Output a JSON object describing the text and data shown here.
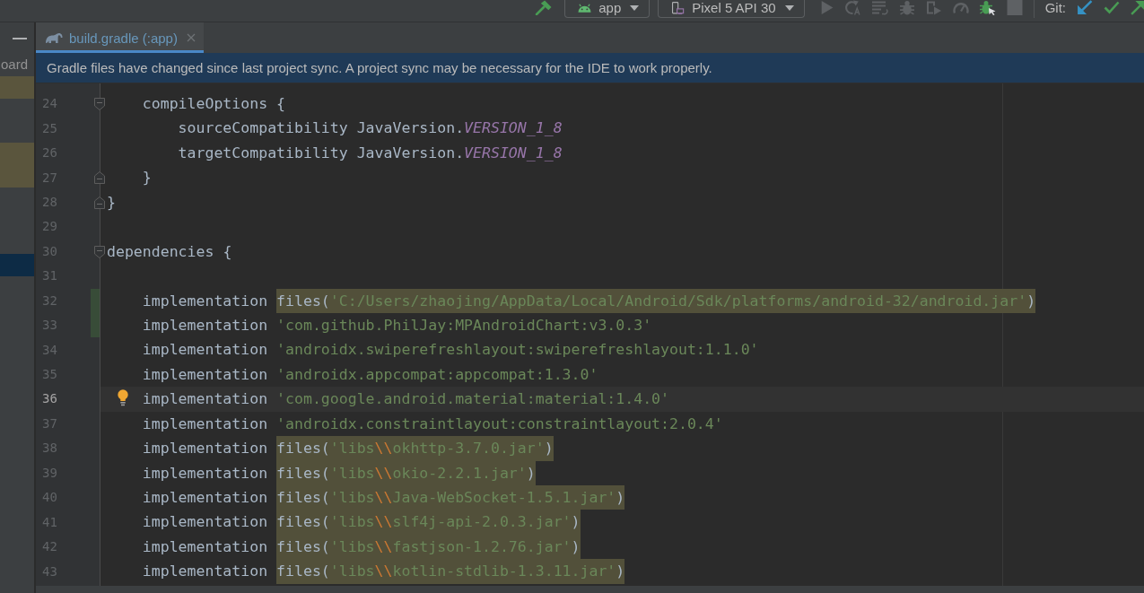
{
  "toolbar": {
    "leading_actions": [
      {
        "kind": "build",
        "disabled": false
      }
    ],
    "configurations": [
      {
        "kind": "module",
        "label": "app"
      },
      {
        "kind": "device",
        "label": "Pixel 5 API 30"
      }
    ],
    "actions": [
      {
        "kind": "run",
        "disabled": true
      },
      {
        "kind": "apply_changes",
        "disabled": true
      },
      {
        "kind": "apply_code_changes",
        "disabled": true
      },
      {
        "kind": "debug",
        "disabled": true
      },
      {
        "kind": "profile",
        "disabled": true
      },
      {
        "kind": "attach_profiler",
        "disabled": true
      },
      {
        "kind": "attach_debugger",
        "disabled": false
      },
      {
        "kind": "stop",
        "disabled": true
      }
    ],
    "git": {
      "label": "Git:"
    }
  },
  "side_panel": {
    "rows": [
      {
        "text": "oard",
        "highlighted": false,
        "selected": false
      },
      {
        "highlighted": true,
        "selected": false
      },
      {
        "highlighted": false,
        "selected": false
      },
      {
        "highlighted": false,
        "selected": false
      },
      {
        "highlighted": true,
        "selected": false
      },
      {
        "highlighted": true,
        "selected": false
      },
      {
        "highlighted": false,
        "selected": false
      },
      {
        "highlighted": false,
        "selected": false
      },
      {
        "highlighted": false,
        "selected": false
      },
      {
        "highlighted": false,
        "selected": true
      }
    ]
  },
  "tabs": [
    {
      "label": "build.gradle (:app)",
      "selected": true,
      "modified": true
    }
  ],
  "notification": {
    "text": "Gradle files have changed since last project sync. A project sync may be necessary for the IDE to work properly."
  },
  "editor": {
    "lines": [
      {
        "children": [
          {
            "number": "24",
            "changed": false,
            "current": false,
            "bulb": false,
            "fold_start": true,
            "fold_end": false,
            "segments": [
              {
                "kind": "plain",
                "text": "compileOptions {",
                "highlighted": false
              }
            ],
            "children": [
              {
                "number": "25",
                "changed": false,
                "current": false,
                "bulb": false,
                "fold_start": false,
                "fold_end": false,
                "segments": [
                  {
                    "kind": "plain",
                    "text": "sourceCompatibility JavaVersion.",
                    "highlighted": false
                  },
                  {
                    "kind": "constant",
                    "text": "VERSION_1_8",
                    "highlighted": false
                  }
                ]
              },
              {
                "number": "26",
                "changed": false,
                "current": false,
                "bulb": false,
                "fold_start": false,
                "fold_end": false,
                "segments": [
                  {
                    "kind": "plain",
                    "text": "targetCompatibility JavaVersion.",
                    "highlighted": false
                  },
                  {
                    "kind": "constant",
                    "text": "VERSION_1_8",
                    "highlighted": false
                  }
                ]
              }
            ]
          },
          {
            "number": "27",
            "changed": false,
            "current": false,
            "bulb": false,
            "fold_start": false,
            "fold_end": true,
            "segments": [
              {
                "kind": "plain",
                "text": "}",
                "highlighted": false
              }
            ]
          }
        ]
      },
      {
        "number": "28",
        "changed": false,
        "current": false,
        "bulb": false,
        "fold_start": false,
        "fold_end": true,
        "segments": [
          {
            "kind": "plain",
            "text": "}",
            "highlighted": false
          }
        ]
      },
      {
        "number": "29",
        "changed": false,
        "current": false,
        "bulb": false,
        "fold_start": false,
        "fold_end": false
      },
      {
        "number": "30",
        "changed": false,
        "current": false,
        "bulb": false,
        "fold_start": true,
        "fold_end": false,
        "segments": [
          {
            "kind": "plain",
            "text": "dependencies {",
            "highlighted": false
          }
        ],
        "children": [
          {
            "number": "31",
            "changed": false,
            "current": false,
            "bulb": false,
            "fold_start": false,
            "fold_end": false
          },
          {
            "number": "32",
            "changed": true,
            "current": false,
            "bulb": false,
            "fold_start": false,
            "fold_end": false,
            "segments": [
              {
                "kind": "plain",
                "text": "implementation ",
                "highlighted": false
              },
              {
                "kind": "plain",
                "text": "files(",
                "highlighted": true
              },
              {
                "kind": "string",
                "text": "'C:/Users/zhaojing/AppData/Local/Android/Sdk/platforms/android-32/android.jar'",
                "highlighted": true
              },
              {
                "kind": "plain",
                "text": ")",
                "highlighted": true
              }
            ]
          },
          {
            "number": "33",
            "changed": true,
            "current": false,
            "bulb": false,
            "fold_start": false,
            "fold_end": false,
            "segments": [
              {
                "kind": "plain",
                "text": "implementation ",
                "highlighted": false
              },
              {
                "kind": "string",
                "text": "'com.github.PhilJay:MPAndroidChart:v3.0.3'",
                "highlighted": false
              }
            ]
          },
          {
            "number": "34",
            "changed": false,
            "current": false,
            "bulb": false,
            "fold_start": false,
            "fold_end": false,
            "segments": [
              {
                "kind": "plain",
                "text": "implementation ",
                "highlighted": false
              },
              {
                "kind": "string",
                "text": "'androidx.swiperefreshlayout:swiperefreshlayout:1.1.0'",
                "highlighted": false
              }
            ]
          },
          {
            "number": "35",
            "changed": false,
            "current": false,
            "bulb": false,
            "fold_start": false,
            "fold_end": false,
            "segments": [
              {
                "kind": "plain",
                "text": "implementation ",
                "highlighted": false
              },
              {
                "kind": "string",
                "text": "'androidx.appcompat:appcompat:1.3.0'",
                "highlighted": false
              }
            ]
          },
          {
            "number": "36",
            "changed": false,
            "current": true,
            "bulb": true,
            "fold_start": false,
            "fold_end": false,
            "segments": [
              {
                "kind": "plain",
                "text": "implementation ",
                "highlighted": false
              },
              {
                "kind": "string",
                "text": "'com.google.android.material:material:1.4.0'",
                "highlighted": false
              }
            ]
          },
          {
            "number": "37",
            "changed": false,
            "current": false,
            "bulb": false,
            "fold_start": false,
            "fold_end": false,
            "segments": [
              {
                "kind": "plain",
                "text": "implementation ",
                "highlighted": false
              },
              {
                "kind": "string",
                "text": "'androidx.constraintlayout:constraintlayout:2.0.4'",
                "highlighted": false
              }
            ]
          },
          {
            "number": "38",
            "changed": false,
            "current": false,
            "bulb": false,
            "fold_start": false,
            "fold_end": false,
            "segments": [
              {
                "kind": "plain",
                "text": "implementation ",
                "highlighted": false
              },
              {
                "kind": "plain",
                "text": "files(",
                "highlighted": true
              },
              {
                "kind": "string",
                "text": "'libs",
                "highlighted": true
              },
              {
                "kind": "escape",
                "text": "\\\\",
                "highlighted": true
              },
              {
                "kind": "string",
                "text": "okhttp-3.7.0.jar'",
                "highlighted": true
              },
              {
                "kind": "plain",
                "text": ")",
                "highlighted": true
              }
            ]
          },
          {
            "number": "39",
            "changed": false,
            "current": false,
            "bulb": false,
            "fold_start": false,
            "fold_end": false,
            "segments": [
              {
                "kind": "plain",
                "text": "implementation ",
                "highlighted": false
              },
              {
                "kind": "plain",
                "text": "files(",
                "highlighted": true
              },
              {
                "kind": "string",
                "text": "'libs",
                "highlighted": true
              },
              {
                "kind": "escape",
                "text": "\\\\",
                "highlighted": true
              },
              {
                "kind": "string",
                "text": "okio-2.2.1.jar'",
                "highlighted": true
              },
              {
                "kind": "plain",
                "text": ")",
                "highlighted": true
              }
            ]
          },
          {
            "number": "40",
            "changed": false,
            "current": false,
            "bulb": false,
            "fold_start": false,
            "fold_end": false,
            "segments": [
              {
                "kind": "plain",
                "text": "implementation ",
                "highlighted": false
              },
              {
                "kind": "plain",
                "text": "files(",
                "highlighted": true
              },
              {
                "kind": "string",
                "text": "'libs",
                "highlighted": true
              },
              {
                "kind": "escape",
                "text": "\\\\",
                "highlighted": true
              },
              {
                "kind": "string",
                "text": "Java-WebSocket-1.5.1.jar'",
                "highlighted": true
              },
              {
                "kind": "plain",
                "text": ")",
                "highlighted": true
              }
            ]
          },
          {
            "number": "41",
            "changed": false,
            "current": false,
            "bulb": false,
            "fold_start": false,
            "fold_end": false,
            "segments": [
              {
                "kind": "plain",
                "text": "implementation ",
                "highlighted": false
              },
              {
                "kind": "plain",
                "text": "files(",
                "highlighted": true
              },
              {
                "kind": "string",
                "text": "'libs",
                "highlighted": true
              },
              {
                "kind": "escape",
                "text": "\\\\",
                "highlighted": true
              },
              {
                "kind": "string",
                "text": "slf4j-api-2.0.3.jar'",
                "highlighted": true
              },
              {
                "kind": "plain",
                "text": ")",
                "highlighted": true
              }
            ]
          },
          {
            "number": "42",
            "changed": false,
            "current": false,
            "bulb": false,
            "fold_start": false,
            "fold_end": false,
            "segments": [
              {
                "kind": "plain",
                "text": "implementation ",
                "highlighted": false
              },
              {
                "kind": "plain",
                "text": "files(",
                "highlighted": true
              },
              {
                "kind": "string",
                "text": "'libs",
                "highlighted": true
              },
              {
                "kind": "escape",
                "text": "\\\\",
                "highlighted": true
              },
              {
                "kind": "string",
                "text": "fastjson-1.2.76.jar'",
                "highlighted": true
              },
              {
                "kind": "plain",
                "text": ")",
                "highlighted": true
              }
            ]
          },
          {
            "number": "43",
            "changed": false,
            "current": false,
            "bulb": false,
            "fold_start": false,
            "fold_end": false,
            "segments": [
              {
                "kind": "plain",
                "text": "implementation ",
                "highlighted": false
              },
              {
                "kind": "plain",
                "text": "files(",
                "highlighted": true
              },
              {
                "kind": "string",
                "text": "'libs",
                "highlighted": true
              },
              {
                "kind": "escape",
                "text": "\\\\",
                "highlighted": true
              },
              {
                "kind": "string",
                "text": "kotlin-stdlib-1.3.11.jar'",
                "highlighted": true
              },
              {
                "kind": "plain",
                "text": ")",
                "highlighted": true
              }
            ]
          }
        ]
      }
    ]
  }
}
